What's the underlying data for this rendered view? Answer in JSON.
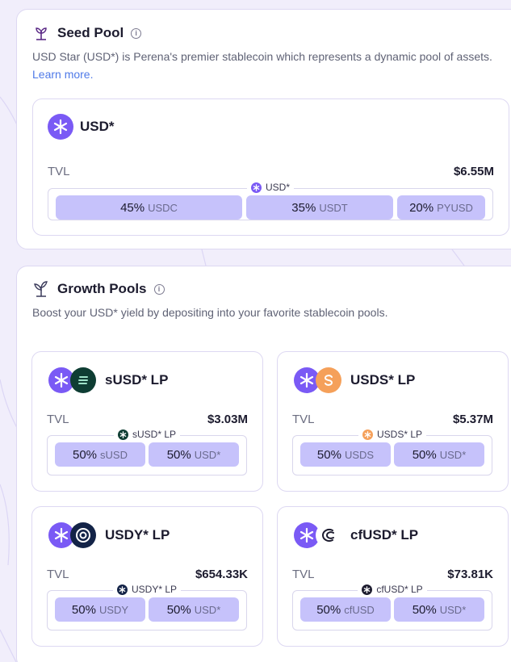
{
  "seed_pool": {
    "title": "Seed Pool",
    "description": "USD Star (USD*) is Perena's premier stablecoin which represents a dynamic pool of assets.",
    "learn_more": "Learn more.",
    "pool": {
      "name": "USD*",
      "tvl_label": "TVL",
      "tvl_value": "$6.55M",
      "legend": "USD*",
      "allocations": [
        {
          "pct": "45%",
          "symbol": "USDC"
        },
        {
          "pct": "35%",
          "symbol": "USDT"
        },
        {
          "pct": "20%",
          "symbol": "PYUSD"
        }
      ]
    }
  },
  "growth_pools": {
    "title": "Growth Pools",
    "description": "Boost your USD* yield by depositing into your favorite stablecoin pools.",
    "pools": [
      {
        "name": "sUSD* LP",
        "tvl_label": "TVL",
        "tvl_value": "$3.03M",
        "legend": "sUSD* LP",
        "second_icon": "susd-icon",
        "second_color": "#0e3d33",
        "allocations": [
          {
            "pct": "50%",
            "symbol": "sUSD"
          },
          {
            "pct": "50%",
            "symbol": "USD*"
          }
        ]
      },
      {
        "name": "USDS* LP",
        "tvl_label": "TVL",
        "tvl_value": "$5.37M",
        "legend": "USDS* LP",
        "second_icon": "usds-icon",
        "second_color": "#f5a05a",
        "allocations": [
          {
            "pct": "50%",
            "symbol": "USDS"
          },
          {
            "pct": "50%",
            "symbol": "USD*"
          }
        ]
      },
      {
        "name": "USDY* LP",
        "tvl_label": "TVL",
        "tvl_value": "$654.33K",
        "legend": "USDY* LP",
        "second_icon": "usdy-icon",
        "second_color": "#132347",
        "allocations": [
          {
            "pct": "50%",
            "symbol": "USDY"
          },
          {
            "pct": "50%",
            "symbol": "USD*"
          }
        ]
      },
      {
        "name": "cfUSD* LP",
        "tvl_label": "TVL",
        "tvl_value": "$73.81K",
        "legend": "cfUSD* LP",
        "second_icon": "cfusd-icon",
        "second_color": "#ffffff",
        "allocations": [
          {
            "pct": "50%",
            "symbol": "cfUSD"
          },
          {
            "pct": "50%",
            "symbol": "USD*"
          }
        ]
      }
    ]
  },
  "colors": {
    "accent": "#7a5af5",
    "segment": "#c6c2fb",
    "link": "#4f7ae8",
    "page_bg": "#f1eefb"
  }
}
